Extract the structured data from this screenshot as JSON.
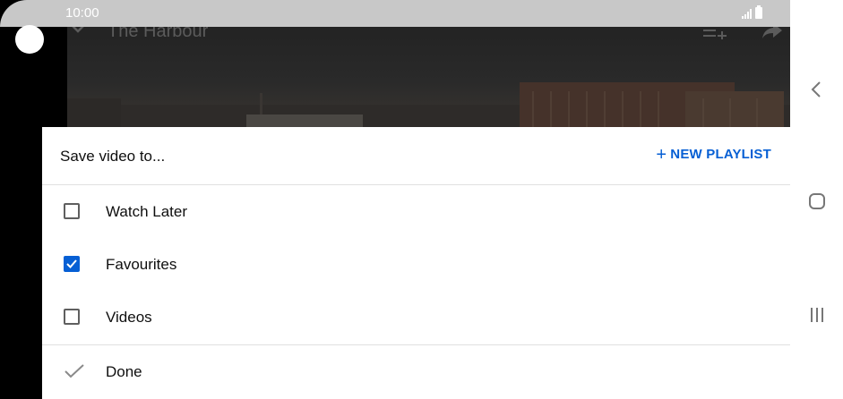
{
  "status_bar": {
    "time": "10:00"
  },
  "video": {
    "title": "The Harbour",
    "icons": [
      "chevron-down-icon",
      "add-to-queue-icon",
      "share-icon"
    ]
  },
  "sheet": {
    "title": "Save video to...",
    "new_playlist_label": "NEW PLAYLIST",
    "options": [
      {
        "label": "Watch Later",
        "checked": false
      },
      {
        "label": "Favourites",
        "checked": true
      },
      {
        "label": "Videos",
        "checked": false
      }
    ],
    "done_label": "Done"
  },
  "colors": {
    "accent": "#065fd4",
    "status_bar": "#c8c8c8",
    "checkbox_border": "#5f5f5f",
    "divider": "#e0e0e0"
  },
  "nav_bar": {
    "icons": [
      "back-icon",
      "home-icon",
      "recents-icon"
    ]
  }
}
